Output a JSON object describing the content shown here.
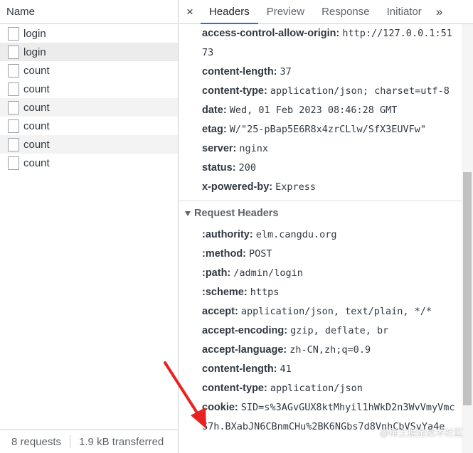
{
  "network": {
    "name_header": "Name",
    "requests": [
      {
        "name": "login"
      },
      {
        "name": "login"
      },
      {
        "name": "count"
      },
      {
        "name": "count"
      },
      {
        "name": "count"
      },
      {
        "name": "count"
      },
      {
        "name": "count"
      },
      {
        "name": "count"
      }
    ],
    "status_requests": "8 requests",
    "status_transferred": "1.9 kB transferred"
  },
  "tabs": {
    "close_glyph": "×",
    "items": [
      "Headers",
      "Preview",
      "Response",
      "Initiator"
    ],
    "active": "Headers",
    "more_glyph": "»"
  },
  "response_headers": [
    {
      "key": "access-control-allow-origin:",
      "value": "http://127.0.0.1:5173"
    },
    {
      "key": "content-length:",
      "value": "37"
    },
    {
      "key": "content-type:",
      "value": "application/json; charset=utf-8"
    },
    {
      "key": "date:",
      "value": "Wed, 01 Feb 2023 08:46:28 GMT"
    },
    {
      "key": "etag:",
      "value": "W/\"25-pBap5E6R8x4zrCLlw/SfX3EUVFw\""
    },
    {
      "key": "server:",
      "value": "nginx"
    },
    {
      "key": "status:",
      "value": "200"
    },
    {
      "key": "x-powered-by:",
      "value": "Express"
    }
  ],
  "request_section_title": "Request Headers",
  "request_headers": [
    {
      "key": ":authority:",
      "value": "elm.cangdu.org"
    },
    {
      "key": ":method:",
      "value": "POST"
    },
    {
      "key": ":path:",
      "value": "/admin/login"
    },
    {
      "key": ":scheme:",
      "value": "https"
    },
    {
      "key": "accept:",
      "value": "application/json, text/plain, */*"
    },
    {
      "key": "accept-encoding:",
      "value": "gzip, deflate, br"
    },
    {
      "key": "accept-language:",
      "value": "zh-CN,zh;q=0.9"
    },
    {
      "key": "content-length:",
      "value": "41"
    },
    {
      "key": "content-type:",
      "value": "application/json"
    },
    {
      "key": "cookie:",
      "value": "SID=s%3AGvGUX8ktMhyil1hWkD2n3WvVmyVmcS7h.BXabJN6CBnmCHu%2BK6NGbs7d8VnhCbVSvYa4e"
    }
  ],
  "watermark": "@稀土掘金技术社区",
  "colors": {
    "accent": "#1a73e8",
    "arrow": "#e8231f"
  }
}
